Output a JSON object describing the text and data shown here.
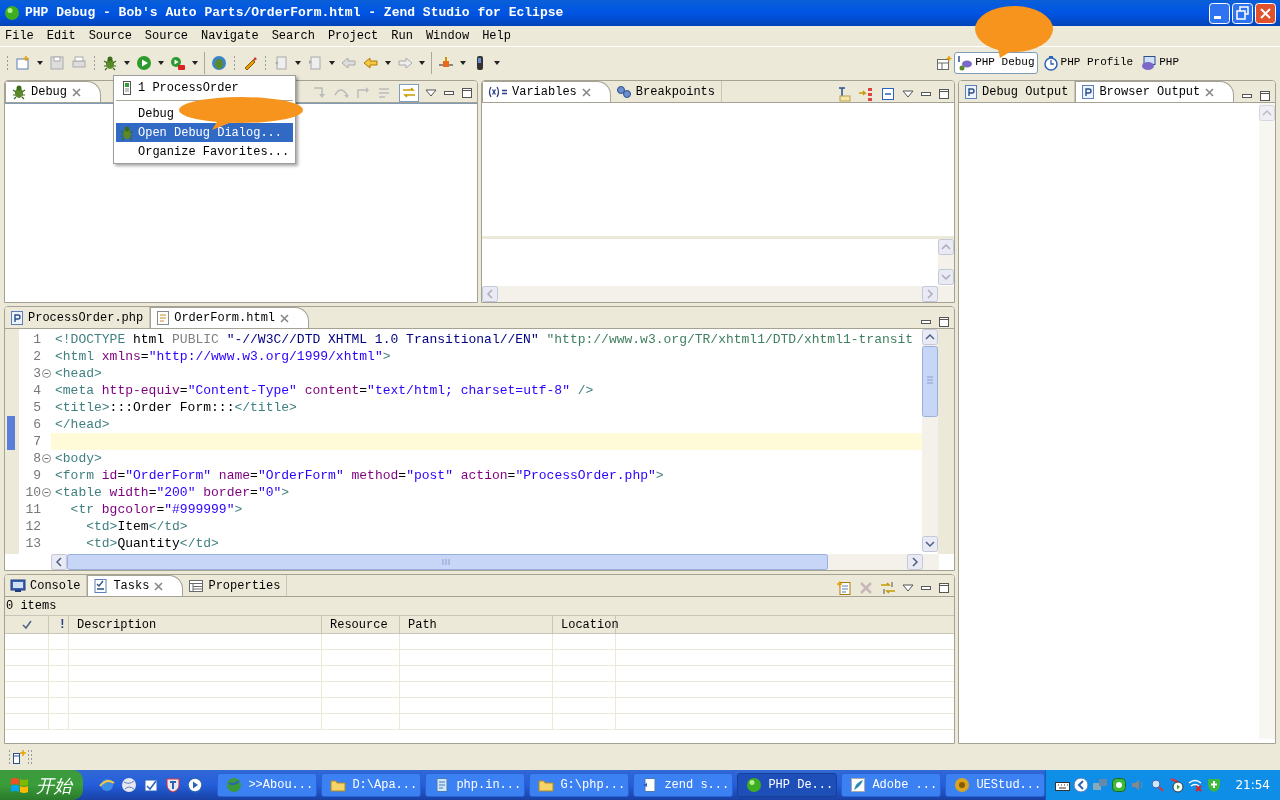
{
  "window": {
    "title": "PHP Debug - Bob's Auto Parts/OrderForm.html - Zend Studio for Eclipse"
  },
  "menu": [
    "File",
    "Edit",
    "Source",
    "Source",
    "Navigate",
    "Search",
    "Project",
    "Run",
    "Window",
    "Help"
  ],
  "perspectives": [
    {
      "label": "PHP Debug",
      "selected": true
    },
    {
      "label": "PHP Profile",
      "selected": false
    },
    {
      "label": "PHP",
      "selected": false
    }
  ],
  "launch_menu": {
    "items": [
      {
        "kind": "launch",
        "label": "1 ProcessOrder",
        "selected": false
      },
      {
        "kind": "separator"
      },
      {
        "kind": "action",
        "label": "Debug",
        "selected": false
      },
      {
        "kind": "dialog",
        "label": "Open Debug Dialog...",
        "selected": true
      },
      {
        "kind": "action",
        "label": "Organize Favorites...",
        "selected": false
      }
    ]
  },
  "debug_view": {
    "tabs": [
      {
        "label": "Debug",
        "selected": true,
        "closable": true
      }
    ]
  },
  "variables_view": {
    "tabs": [
      {
        "label": "Variables",
        "selected": true,
        "closable": true
      },
      {
        "label": "Breakpoints",
        "selected": false,
        "closable": false
      }
    ]
  },
  "output_view": {
    "tabs": [
      {
        "label": "Debug Output",
        "selected": false,
        "closable": false
      },
      {
        "label": "Browser Output",
        "selected": true,
        "closable": true
      }
    ]
  },
  "editor": {
    "tabs": [
      {
        "label": "ProcessOrder.php",
        "selected": false,
        "closable": false
      },
      {
        "label": "OrderForm.html",
        "selected": true,
        "closable": true
      }
    ],
    "lines": [
      {
        "number": "1",
        "fold": false,
        "current": false,
        "segments": [
          {
            "kind": "tag",
            "text": "<!DOCTYPE"
          },
          {
            "kind": "text",
            "text": " html"
          },
          {
            "kind": "keyword",
            "text": " PUBLIC"
          },
          {
            "kind": "public_id",
            "text": " \"-//W3C//DTD XHTML 1.0 Transitional//EN\""
          },
          {
            "kind": "system_id",
            "text": " \"http://www.w3.org/TR/xhtml1/DTD/xhtml1-transit"
          }
        ]
      },
      {
        "number": "2",
        "fold": false,
        "current": false,
        "segments": [
          {
            "kind": "tag",
            "text": "<html"
          },
          {
            "kind": "attr",
            "text": " xmlns"
          },
          {
            "kind": "text",
            "text": "="
          },
          {
            "kind": "value",
            "text": "\"http://www.w3.org/1999/xhtml\""
          },
          {
            "kind": "tag",
            "text": ">"
          }
        ]
      },
      {
        "number": "3",
        "fold": true,
        "current": false,
        "segments": [
          {
            "kind": "tag",
            "text": "<head>"
          }
        ]
      },
      {
        "number": "4",
        "fold": false,
        "current": false,
        "segments": [
          {
            "kind": "tag",
            "text": "<meta"
          },
          {
            "kind": "attr",
            "text": " http-equiv"
          },
          {
            "kind": "text",
            "text": "="
          },
          {
            "kind": "value",
            "text": "\"Content-Type\""
          },
          {
            "kind": "attr",
            "text": " content"
          },
          {
            "kind": "text",
            "text": "="
          },
          {
            "kind": "value",
            "text": "\"text/html; charset=utf-8\""
          },
          {
            "kind": "tag",
            "text": " />"
          }
        ]
      },
      {
        "number": "5",
        "fold": false,
        "current": false,
        "segments": [
          {
            "kind": "tag",
            "text": "<title>"
          },
          {
            "kind": "text",
            "text": ":::Order Form:::"
          },
          {
            "kind": "tag",
            "text": "</title>"
          }
        ]
      },
      {
        "number": "6",
        "fold": false,
        "current": false,
        "segments": [
          {
            "kind": "tag",
            "text": "</head>"
          }
        ]
      },
      {
        "number": "7",
        "fold": false,
        "current": true
      },
      {
        "number": "8",
        "fold": true,
        "current": false,
        "segments": [
          {
            "kind": "tag",
            "text": "<body>"
          }
        ]
      },
      {
        "number": "9",
        "fold": false,
        "current": false,
        "segments": [
          {
            "kind": "tag",
            "text": "<form"
          },
          {
            "kind": "attr",
            "text": " id"
          },
          {
            "kind": "text",
            "text": "="
          },
          {
            "kind": "value",
            "text": "\"OrderForm\""
          },
          {
            "kind": "attr",
            "text": " name"
          },
          {
            "kind": "text",
            "text": "="
          },
          {
            "kind": "value",
            "text": "\"OrderForm\""
          },
          {
            "kind": "attr",
            "text": " method"
          },
          {
            "kind": "text",
            "text": "="
          },
          {
            "kind": "value",
            "text": "\"post\""
          },
          {
            "kind": "attr",
            "text": " action"
          },
          {
            "kind": "text",
            "text": "="
          },
          {
            "kind": "value",
            "text": "\"ProcessOrder.php\""
          },
          {
            "kind": "tag",
            "text": ">"
          }
        ]
      },
      {
        "number": "10",
        "fold": true,
        "current": false,
        "segments": [
          {
            "kind": "tag",
            "text": "<table"
          },
          {
            "kind": "attr",
            "text": " width"
          },
          {
            "kind": "text",
            "text": "="
          },
          {
            "kind": "value",
            "text": "\"200\""
          },
          {
            "kind": "attr",
            "text": " border"
          },
          {
            "kind": "text",
            "text": "="
          },
          {
            "kind": "value",
            "text": "\"0\""
          },
          {
            "kind": "tag",
            "text": ">"
          }
        ]
      },
      {
        "number": "11",
        "fold": false,
        "current": false,
        "segments": [
          {
            "kind": "tag",
            "text": "  <tr"
          },
          {
            "kind": "attr",
            "text": " bgcolor"
          },
          {
            "kind": "text",
            "text": "="
          },
          {
            "kind": "value",
            "text": "\"#999999\""
          },
          {
            "kind": "tag",
            "text": ">"
          }
        ]
      },
      {
        "number": "12",
        "fold": false,
        "current": false,
        "segments": [
          {
            "kind": "tag",
            "text": "    <td>"
          },
          {
            "kind": "text",
            "text": "Item"
          },
          {
            "kind": "tag",
            "text": "</td>"
          }
        ]
      },
      {
        "number": "13",
        "fold": false,
        "current": false,
        "segments": [
          {
            "kind": "tag",
            "text": "    <td>"
          },
          {
            "kind": "text",
            "text": "Quantity"
          },
          {
            "kind": "tag",
            "text": "</td>"
          }
        ]
      }
    ]
  },
  "tasks_view": {
    "tabs": [
      {
        "label": "Console",
        "selected": false,
        "closable": false
      },
      {
        "label": "Tasks",
        "selected": true,
        "closable": true
      },
      {
        "label": "Properties",
        "selected": false,
        "closable": false
      }
    ],
    "summary": "0 items",
    "columns": [
      "!",
      "Description",
      "Resource",
      "Path",
      "Location"
    ]
  },
  "taskbar": {
    "start": "开始",
    "tasks": [
      {
        "label": ">>Abou...",
        "selected": false
      },
      {
        "label": "D:\\Apa...",
        "selected": false
      },
      {
        "label": "php.in...",
        "selected": false
      },
      {
        "label": "G:\\php...",
        "selected": false
      },
      {
        "label": "zend s...",
        "selected": false
      },
      {
        "label": "PHP De...",
        "selected": true
      },
      {
        "label": "Adobe ...",
        "selected": false
      },
      {
        "label": "UEStud...",
        "selected": false
      }
    ],
    "clock": "21:54"
  }
}
